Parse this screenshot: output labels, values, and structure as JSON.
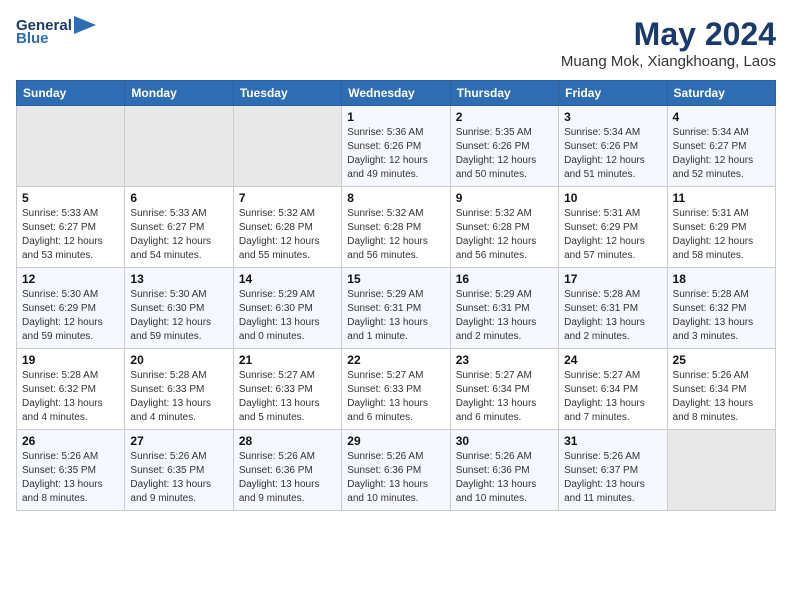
{
  "header": {
    "logo_line1": "General",
    "logo_line2": "Blue",
    "title": "May 2024",
    "subtitle": "Muang Mok, Xiangkhoang, Laos"
  },
  "weekdays": [
    "Sunday",
    "Monday",
    "Tuesday",
    "Wednesday",
    "Thursday",
    "Friday",
    "Saturday"
  ],
  "weeks": [
    [
      {
        "day": "",
        "info": ""
      },
      {
        "day": "",
        "info": ""
      },
      {
        "day": "",
        "info": ""
      },
      {
        "day": "1",
        "info": "Sunrise: 5:36 AM\nSunset: 6:26 PM\nDaylight: 12 hours\nand 49 minutes."
      },
      {
        "day": "2",
        "info": "Sunrise: 5:35 AM\nSunset: 6:26 PM\nDaylight: 12 hours\nand 50 minutes."
      },
      {
        "day": "3",
        "info": "Sunrise: 5:34 AM\nSunset: 6:26 PM\nDaylight: 12 hours\nand 51 minutes."
      },
      {
        "day": "4",
        "info": "Sunrise: 5:34 AM\nSunset: 6:27 PM\nDaylight: 12 hours\nand 52 minutes."
      }
    ],
    [
      {
        "day": "5",
        "info": "Sunrise: 5:33 AM\nSunset: 6:27 PM\nDaylight: 12 hours\nand 53 minutes."
      },
      {
        "day": "6",
        "info": "Sunrise: 5:33 AM\nSunset: 6:27 PM\nDaylight: 12 hours\nand 54 minutes."
      },
      {
        "day": "7",
        "info": "Sunrise: 5:32 AM\nSunset: 6:28 PM\nDaylight: 12 hours\nand 55 minutes."
      },
      {
        "day": "8",
        "info": "Sunrise: 5:32 AM\nSunset: 6:28 PM\nDaylight: 12 hours\nand 56 minutes."
      },
      {
        "day": "9",
        "info": "Sunrise: 5:32 AM\nSunset: 6:28 PM\nDaylight: 12 hours\nand 56 minutes."
      },
      {
        "day": "10",
        "info": "Sunrise: 5:31 AM\nSunset: 6:29 PM\nDaylight: 12 hours\nand 57 minutes."
      },
      {
        "day": "11",
        "info": "Sunrise: 5:31 AM\nSunset: 6:29 PM\nDaylight: 12 hours\nand 58 minutes."
      }
    ],
    [
      {
        "day": "12",
        "info": "Sunrise: 5:30 AM\nSunset: 6:29 PM\nDaylight: 12 hours\nand 59 minutes."
      },
      {
        "day": "13",
        "info": "Sunrise: 5:30 AM\nSunset: 6:30 PM\nDaylight: 12 hours\nand 59 minutes."
      },
      {
        "day": "14",
        "info": "Sunrise: 5:29 AM\nSunset: 6:30 PM\nDaylight: 13 hours\nand 0 minutes."
      },
      {
        "day": "15",
        "info": "Sunrise: 5:29 AM\nSunset: 6:31 PM\nDaylight: 13 hours\nand 1 minute."
      },
      {
        "day": "16",
        "info": "Sunrise: 5:29 AM\nSunset: 6:31 PM\nDaylight: 13 hours\nand 2 minutes."
      },
      {
        "day": "17",
        "info": "Sunrise: 5:28 AM\nSunset: 6:31 PM\nDaylight: 13 hours\nand 2 minutes."
      },
      {
        "day": "18",
        "info": "Sunrise: 5:28 AM\nSunset: 6:32 PM\nDaylight: 13 hours\nand 3 minutes."
      }
    ],
    [
      {
        "day": "19",
        "info": "Sunrise: 5:28 AM\nSunset: 6:32 PM\nDaylight: 13 hours\nand 4 minutes."
      },
      {
        "day": "20",
        "info": "Sunrise: 5:28 AM\nSunset: 6:33 PM\nDaylight: 13 hours\nand 4 minutes."
      },
      {
        "day": "21",
        "info": "Sunrise: 5:27 AM\nSunset: 6:33 PM\nDaylight: 13 hours\nand 5 minutes."
      },
      {
        "day": "22",
        "info": "Sunrise: 5:27 AM\nSunset: 6:33 PM\nDaylight: 13 hours\nand 6 minutes."
      },
      {
        "day": "23",
        "info": "Sunrise: 5:27 AM\nSunset: 6:34 PM\nDaylight: 13 hours\nand 6 minutes."
      },
      {
        "day": "24",
        "info": "Sunrise: 5:27 AM\nSunset: 6:34 PM\nDaylight: 13 hours\nand 7 minutes."
      },
      {
        "day": "25",
        "info": "Sunrise: 5:26 AM\nSunset: 6:34 PM\nDaylight: 13 hours\nand 8 minutes."
      }
    ],
    [
      {
        "day": "26",
        "info": "Sunrise: 5:26 AM\nSunset: 6:35 PM\nDaylight: 13 hours\nand 8 minutes."
      },
      {
        "day": "27",
        "info": "Sunrise: 5:26 AM\nSunset: 6:35 PM\nDaylight: 13 hours\nand 9 minutes."
      },
      {
        "day": "28",
        "info": "Sunrise: 5:26 AM\nSunset: 6:36 PM\nDaylight: 13 hours\nand 9 minutes."
      },
      {
        "day": "29",
        "info": "Sunrise: 5:26 AM\nSunset: 6:36 PM\nDaylight: 13 hours\nand 10 minutes."
      },
      {
        "day": "30",
        "info": "Sunrise: 5:26 AM\nSunset: 6:36 PM\nDaylight: 13 hours\nand 10 minutes."
      },
      {
        "day": "31",
        "info": "Sunrise: 5:26 AM\nSunset: 6:37 PM\nDaylight: 13 hours\nand 11 minutes."
      },
      {
        "day": "",
        "info": ""
      }
    ]
  ]
}
